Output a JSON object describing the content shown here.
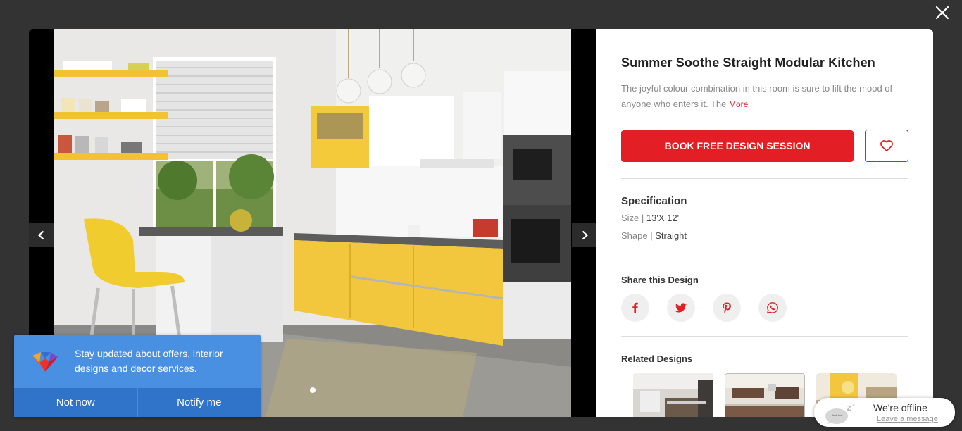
{
  "icons": {
    "close": "close-icon",
    "prev": "chevron-left-icon",
    "next": "chevron-right-icon",
    "favorite": "heart-icon",
    "facebook": "facebook-icon",
    "twitter": "twitter-icon",
    "pinterest": "pinterest-icon",
    "whatsapp": "whatsapp-icon",
    "chat": "sleeping-chat-icon"
  },
  "colors": {
    "accent": "#e31e24",
    "overlay": "#333333",
    "notify_blue": "#4a90e2",
    "notify_blue_dark": "#2f74c9"
  },
  "gallery": {
    "slide_count": 1,
    "active_slide": 1
  },
  "design": {
    "title": "Summer Soothe Straight Modular Kitchen",
    "description": "The joyful colour combination in this room is sure to lift the mood of anyone who enters it. The",
    "more_label": "More",
    "book_label": "BOOK FREE DESIGN SESSION"
  },
  "specification": {
    "heading": "Specification",
    "size_label": "Size",
    "size_value": "13'X 12'",
    "shape_label": "Shape",
    "shape_value": "Straight"
  },
  "share": {
    "heading": "Share this Design"
  },
  "related": {
    "heading": "Related Designs",
    "count": 3
  },
  "notification": {
    "text": "Stay updated about offers, interior designs and decor services.",
    "decline_label": "Not now",
    "accept_label": "Notify me"
  },
  "chat": {
    "status": "We're offline",
    "link": "Leave a message"
  }
}
